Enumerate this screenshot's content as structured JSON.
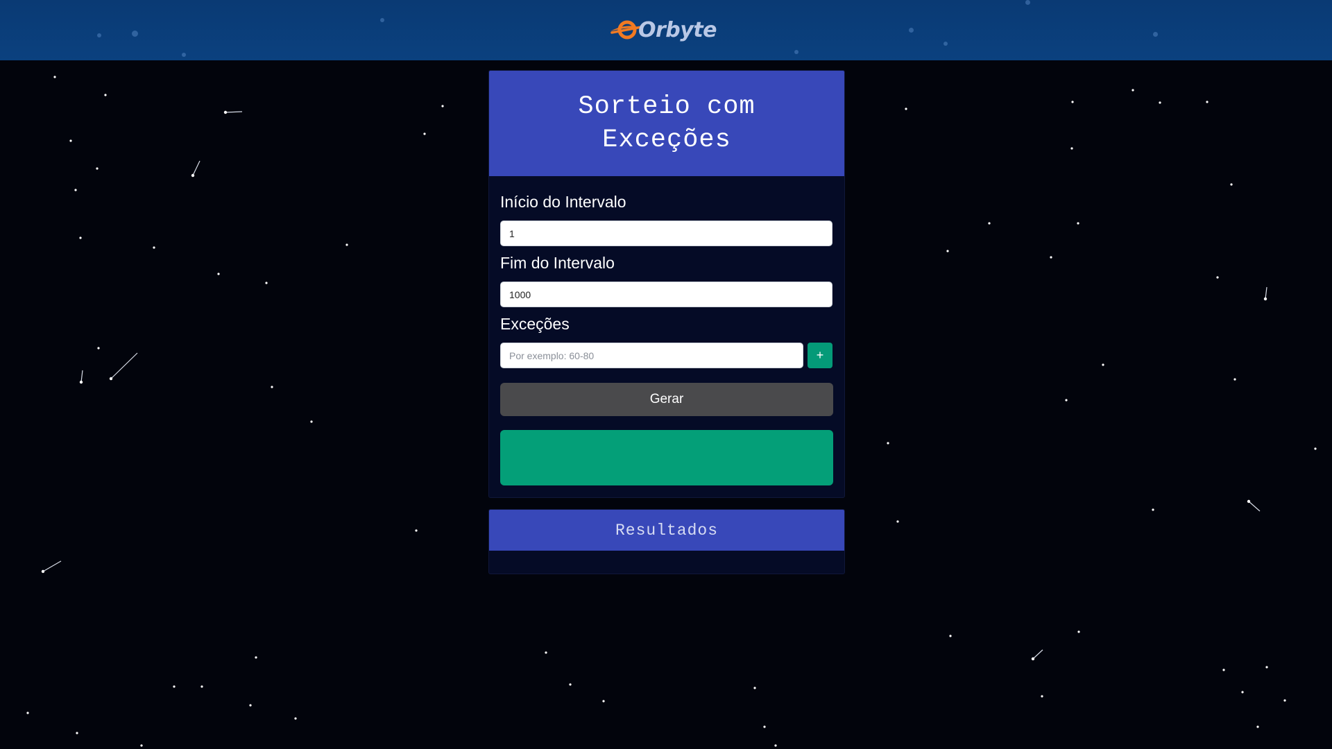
{
  "app": {
    "logo_text": "Orbyte",
    "accent_color": "#3848b9",
    "success_color": "#049f78",
    "logo_color": "#f27a22"
  },
  "form": {
    "title": "Sorteio com Exceções",
    "start": {
      "label": "Início do Intervalo",
      "value": "1"
    },
    "end": {
      "label": "Fim do Intervalo",
      "value": "1000"
    },
    "exceptions": {
      "label": "Exceções",
      "value": "",
      "placeholder": "Por exemplo: 60-80",
      "add_label": "+"
    },
    "generate_label": "Gerar",
    "result_value": ""
  },
  "results": {
    "title": "Resultados"
  }
}
